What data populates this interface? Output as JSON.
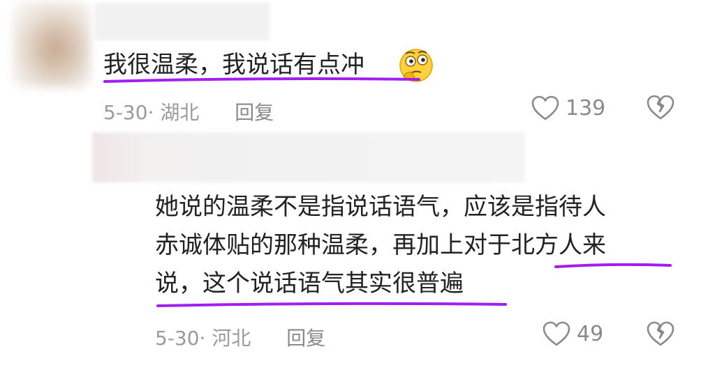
{
  "comment": {
    "text": "我很温柔，我说话有点冲",
    "emoji": "thinking-face-emoji",
    "date_location": "5-30· 湖北",
    "reply_label": "回复",
    "like_count": "139"
  },
  "reply": {
    "lines": [
      "她说的温柔不是指说话语气，应该是指待人",
      "赤诚体贴的那种温柔，再加上对于北方人来",
      "说，这个说话语气其实很普遍"
    ],
    "date_location": "5-30· 河北",
    "reply_label": "回复",
    "like_count": "49"
  },
  "colors": {
    "underline": "#a21ef0",
    "meta_text": "#9a9a9a",
    "body_text": "#222222"
  }
}
